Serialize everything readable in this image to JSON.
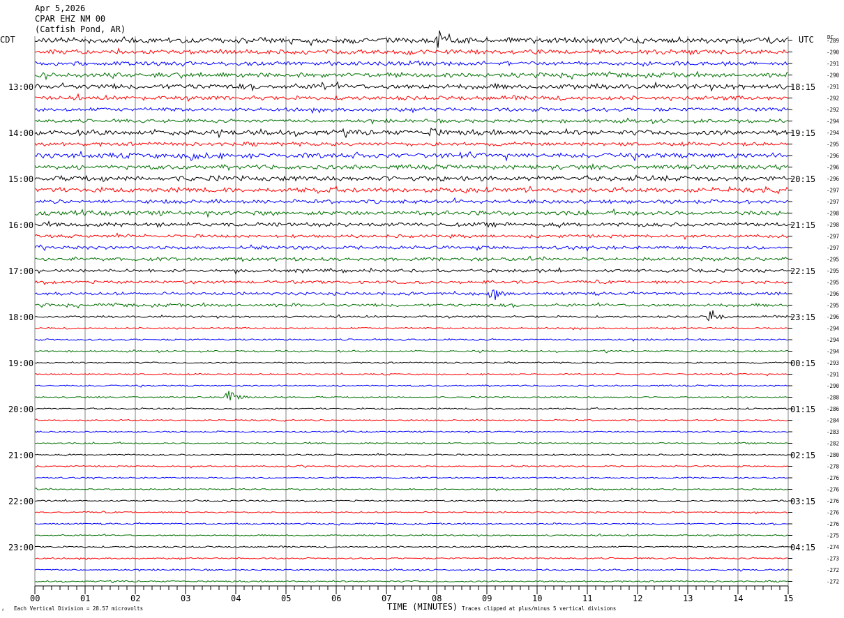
{
  "header": {
    "date": "Apr 5,2026",
    "station": "CPAR EHZ NM 00",
    "location": "(Catfish Pond, AR)"
  },
  "labels": {
    "left_zone": "CDT",
    "right_zone": "UTC",
    "dc": "DC",
    "x_axis_title": "TIME (MINUTES)",
    "scale_note": "Each Vertical Division =   28.57 microvolts",
    "clip_note": "Traces clipped at plus/minus 5 vertical divisions",
    "corner_mark": "ᴬ"
  },
  "chart_data": {
    "type": "line",
    "title": "CPAR EHZ NM 00 (Catfish Pond, AR) Apr 5,2026",
    "xlabel": "TIME (MINUTES)",
    "ylabel": "",
    "xlim": [
      0,
      15
    ],
    "x_ticks": [
      "00",
      "01",
      "02",
      "03",
      "04",
      "05",
      "06",
      "07",
      "08",
      "09",
      "10",
      "11",
      "12",
      "13",
      "14",
      "15"
    ],
    "grid": true,
    "line_minutes": 15,
    "left_time_labels": [
      "13:00",
      "14:00",
      "15:00",
      "16:00",
      "17:00",
      "18:00",
      "19:00",
      "20:00",
      "21:00",
      "22:00",
      "23:00"
    ],
    "right_time_labels": [
      "18:15",
      "19:15",
      "20:15",
      "21:15",
      "22:15",
      "23:15",
      "00:15",
      "01:15",
      "02:15",
      "03:15",
      "04:15"
    ],
    "trace_colors": [
      "#000000",
      "#ff0000",
      "#0000ff",
      "#007000"
    ],
    "dc_offsets": [
      -289,
      -290,
      -291,
      -290,
      -291,
      -292,
      -292,
      -294,
      -294,
      -295,
      -296,
      -296,
      -296,
      -297,
      -297,
      -298,
      -298,
      -297,
      -297,
      -295,
      -295,
      -295,
      -296,
      -295,
      -296,
      -294,
      -294,
      -294,
      -293,
      -291,
      -290,
      -288,
      -286,
      -284,
      -283,
      -282,
      -280,
      -278,
      -276,
      -276,
      -276,
      -276,
      -276,
      -275,
      -274,
      -273,
      -272,
      -272
    ],
    "noise_levels": [
      3.2,
      2.6,
      2.4,
      2.6,
      3.0,
      2.4,
      2.2,
      2.0,
      3.0,
      2.2,
      3.0,
      2.6,
      3.0,
      2.8,
      2.2,
      2.6,
      2.4,
      1.8,
      2.0,
      2.0,
      1.8,
      1.8,
      1.8,
      1.8,
      1.2,
      1.0,
      1.0,
      1.0,
      0.9,
      0.9,
      0.9,
      0.9,
      0.9,
      0.9,
      0.9,
      0.9,
      0.9,
      0.9,
      0.9,
      0.9,
      0.9,
      0.9,
      0.9,
      0.9,
      0.9,
      0.9,
      0.9,
      0.9
    ],
    "events": [
      {
        "trace": 0,
        "minute": 8.05,
        "amplitude": 12
      },
      {
        "trace": 4,
        "minute": 5.7,
        "amplitude": 6
      },
      {
        "trace": 8,
        "minute": 7.9,
        "amplitude": 6
      },
      {
        "trace": 10,
        "minute": 3.1,
        "amplitude": 6
      },
      {
        "trace": 22,
        "minute": 9.1,
        "amplitude": 9
      },
      {
        "trace": 24,
        "minute": 13.45,
        "amplitude": 12
      },
      {
        "trace": 31,
        "minute": 3.85,
        "amplitude": 16
      }
    ]
  }
}
